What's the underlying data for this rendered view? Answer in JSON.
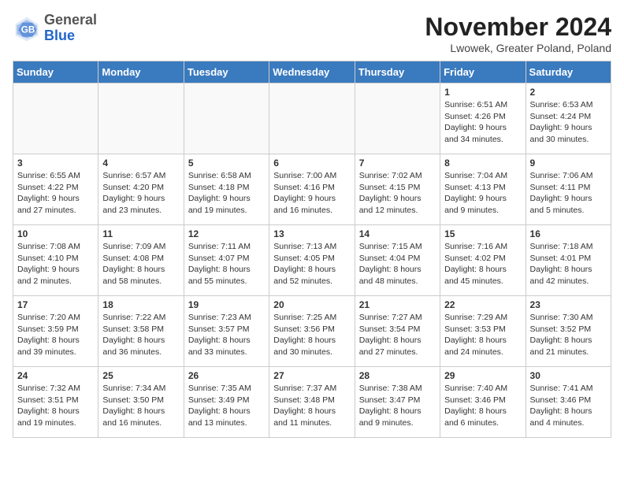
{
  "logo": {
    "general": "General",
    "blue": "Blue"
  },
  "title": "November 2024",
  "subtitle": "Lwowek, Greater Poland, Poland",
  "days_of_week": [
    "Sunday",
    "Monday",
    "Tuesday",
    "Wednesday",
    "Thursday",
    "Friday",
    "Saturday"
  ],
  "weeks": [
    [
      {
        "day": "",
        "info": ""
      },
      {
        "day": "",
        "info": ""
      },
      {
        "day": "",
        "info": ""
      },
      {
        "day": "",
        "info": ""
      },
      {
        "day": "",
        "info": ""
      },
      {
        "day": "1",
        "info": "Sunrise: 6:51 AM\nSunset: 4:26 PM\nDaylight: 9 hours and 34 minutes."
      },
      {
        "day": "2",
        "info": "Sunrise: 6:53 AM\nSunset: 4:24 PM\nDaylight: 9 hours and 30 minutes."
      }
    ],
    [
      {
        "day": "3",
        "info": "Sunrise: 6:55 AM\nSunset: 4:22 PM\nDaylight: 9 hours and 27 minutes."
      },
      {
        "day": "4",
        "info": "Sunrise: 6:57 AM\nSunset: 4:20 PM\nDaylight: 9 hours and 23 minutes."
      },
      {
        "day": "5",
        "info": "Sunrise: 6:58 AM\nSunset: 4:18 PM\nDaylight: 9 hours and 19 minutes."
      },
      {
        "day": "6",
        "info": "Sunrise: 7:00 AM\nSunset: 4:16 PM\nDaylight: 9 hours and 16 minutes."
      },
      {
        "day": "7",
        "info": "Sunrise: 7:02 AM\nSunset: 4:15 PM\nDaylight: 9 hours and 12 minutes."
      },
      {
        "day": "8",
        "info": "Sunrise: 7:04 AM\nSunset: 4:13 PM\nDaylight: 9 hours and 9 minutes."
      },
      {
        "day": "9",
        "info": "Sunrise: 7:06 AM\nSunset: 4:11 PM\nDaylight: 9 hours and 5 minutes."
      }
    ],
    [
      {
        "day": "10",
        "info": "Sunrise: 7:08 AM\nSunset: 4:10 PM\nDaylight: 9 hours and 2 minutes."
      },
      {
        "day": "11",
        "info": "Sunrise: 7:09 AM\nSunset: 4:08 PM\nDaylight: 8 hours and 58 minutes."
      },
      {
        "day": "12",
        "info": "Sunrise: 7:11 AM\nSunset: 4:07 PM\nDaylight: 8 hours and 55 minutes."
      },
      {
        "day": "13",
        "info": "Sunrise: 7:13 AM\nSunset: 4:05 PM\nDaylight: 8 hours and 52 minutes."
      },
      {
        "day": "14",
        "info": "Sunrise: 7:15 AM\nSunset: 4:04 PM\nDaylight: 8 hours and 48 minutes."
      },
      {
        "day": "15",
        "info": "Sunrise: 7:16 AM\nSunset: 4:02 PM\nDaylight: 8 hours and 45 minutes."
      },
      {
        "day": "16",
        "info": "Sunrise: 7:18 AM\nSunset: 4:01 PM\nDaylight: 8 hours and 42 minutes."
      }
    ],
    [
      {
        "day": "17",
        "info": "Sunrise: 7:20 AM\nSunset: 3:59 PM\nDaylight: 8 hours and 39 minutes."
      },
      {
        "day": "18",
        "info": "Sunrise: 7:22 AM\nSunset: 3:58 PM\nDaylight: 8 hours and 36 minutes."
      },
      {
        "day": "19",
        "info": "Sunrise: 7:23 AM\nSunset: 3:57 PM\nDaylight: 8 hours and 33 minutes."
      },
      {
        "day": "20",
        "info": "Sunrise: 7:25 AM\nSunset: 3:56 PM\nDaylight: 8 hours and 30 minutes."
      },
      {
        "day": "21",
        "info": "Sunrise: 7:27 AM\nSunset: 3:54 PM\nDaylight: 8 hours and 27 minutes."
      },
      {
        "day": "22",
        "info": "Sunrise: 7:29 AM\nSunset: 3:53 PM\nDaylight: 8 hours and 24 minutes."
      },
      {
        "day": "23",
        "info": "Sunrise: 7:30 AM\nSunset: 3:52 PM\nDaylight: 8 hours and 21 minutes."
      }
    ],
    [
      {
        "day": "24",
        "info": "Sunrise: 7:32 AM\nSunset: 3:51 PM\nDaylight: 8 hours and 19 minutes."
      },
      {
        "day": "25",
        "info": "Sunrise: 7:34 AM\nSunset: 3:50 PM\nDaylight: 8 hours and 16 minutes."
      },
      {
        "day": "26",
        "info": "Sunrise: 7:35 AM\nSunset: 3:49 PM\nDaylight: 8 hours and 13 minutes."
      },
      {
        "day": "27",
        "info": "Sunrise: 7:37 AM\nSunset: 3:48 PM\nDaylight: 8 hours and 11 minutes."
      },
      {
        "day": "28",
        "info": "Sunrise: 7:38 AM\nSunset: 3:47 PM\nDaylight: 8 hours and 9 minutes."
      },
      {
        "day": "29",
        "info": "Sunrise: 7:40 AM\nSunset: 3:46 PM\nDaylight: 8 hours and 6 minutes."
      },
      {
        "day": "30",
        "info": "Sunrise: 7:41 AM\nSunset: 3:46 PM\nDaylight: 8 hours and 4 minutes."
      }
    ]
  ]
}
